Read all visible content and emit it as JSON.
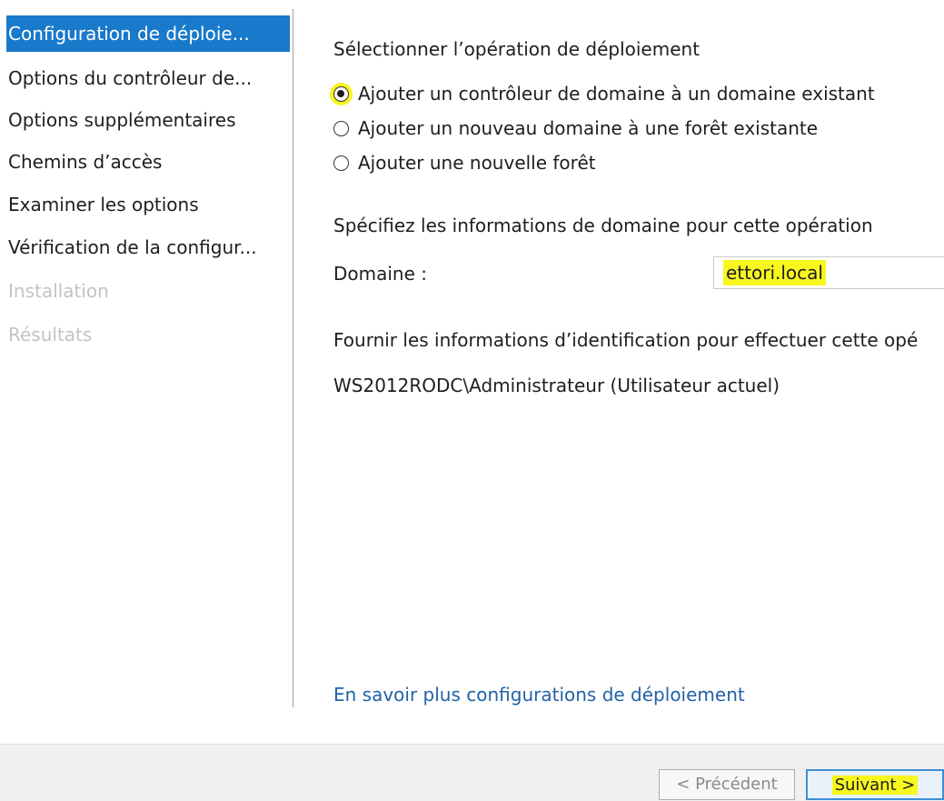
{
  "sidebar": {
    "items": [
      {
        "label": "Configuration de déploie...",
        "state": "selected"
      },
      {
        "label": "Options du contrôleur de...",
        "state": "normal"
      },
      {
        "label": "Options supplémentaires",
        "state": "normal"
      },
      {
        "label": "Chemins d’accès",
        "state": "normal"
      },
      {
        "label": "Examiner les options",
        "state": "normal"
      },
      {
        "label": "Vérification de la configur...",
        "state": "normal"
      },
      {
        "label": "Installation",
        "state": "disabled"
      },
      {
        "label": "Résultats",
        "state": "disabled"
      }
    ]
  },
  "main": {
    "operation_heading": "Sélectionner l’opération de déploiement",
    "radio_options": [
      {
        "label": "Ajouter un contrôleur de domaine à un domaine existant",
        "checked": true
      },
      {
        "label": "Ajouter un nouveau domaine à une forêt existante",
        "checked": false
      },
      {
        "label": "Ajouter une nouvelle forêt",
        "checked": false
      }
    ],
    "domain_info_heading": "Spécifiez les informations de domaine pour cette opération",
    "domain_label": "Domaine :",
    "domain_value": "ettori.local",
    "credentials_heading": "Fournir les informations d’identification pour effectuer cette opé",
    "credentials_user": "WS2012RODC\\Administrateur (Utilisateur actuel)",
    "learn_more_link": "En savoir plus configurations de déploiement"
  },
  "footer": {
    "previous_label": "< Précédent",
    "next_label": "Suivant >"
  },
  "colors": {
    "selection": "#1979ca",
    "highlight": "#f7f71f",
    "link": "#2262a8"
  }
}
